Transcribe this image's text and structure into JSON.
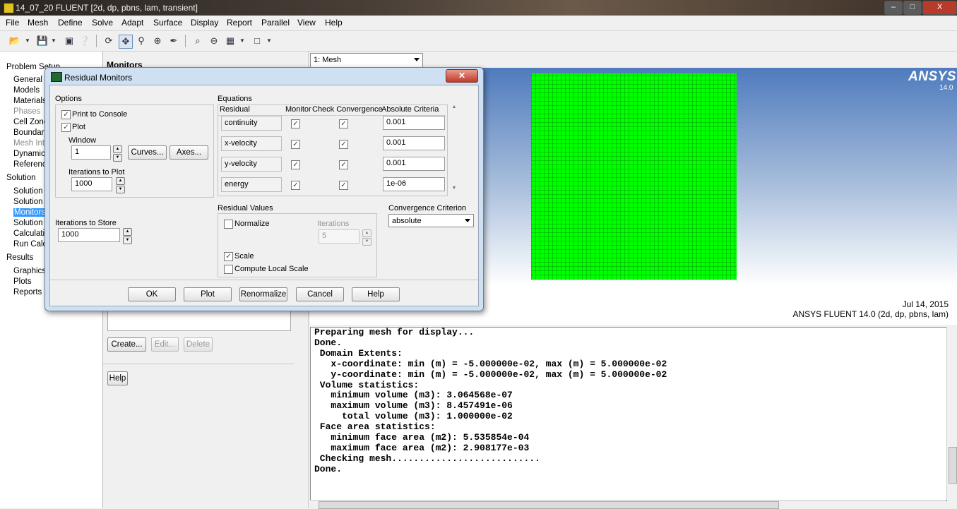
{
  "window": {
    "title": "14_07_20 FLUENT  [2d, dp, pbns, lam, transient]",
    "min": "–",
    "max": "□",
    "close": "X"
  },
  "menu": [
    "File",
    "Mesh",
    "Define",
    "Solve",
    "Adapt",
    "Surface",
    "Display",
    "Report",
    "Parallel",
    "View",
    "Help"
  ],
  "tree": {
    "problem_setup": "Problem Setup",
    "setup_items": [
      "General",
      "Models",
      "Materials",
      "Phases",
      "Cell Zones",
      "Boundary",
      "Mesh Inte",
      "Dynamic",
      "Referenc"
    ],
    "solution": "Solution",
    "solution_items": [
      "Solution M",
      "Solution C",
      "Monitors",
      "Solution I",
      "Calculatio",
      "Run Calcu"
    ],
    "results": "Results",
    "results_items": [
      "Graphics",
      "Plots",
      "Reports"
    ]
  },
  "task": {
    "title": "Monitors",
    "create": "Create...",
    "edit": "Edit...",
    "delete": "Delete",
    "help": "Help"
  },
  "graphics": {
    "view_select": "1: Mesh",
    "logo": "ANSYS",
    "logo_version": "14.0",
    "date": "Jul 14, 2015",
    "product": "ANSYS FLUENT 14.0 (2d, dp, pbns, lam)"
  },
  "console": [
    "Preparing mesh for display...",
    "Done.",
    "",
    " Domain Extents:",
    "   x-coordinate: min (m) = -5.000000e-02, max (m) = 5.000000e-02",
    "   y-coordinate: min (m) = -5.000000e-02, max (m) = 5.000000e-02",
    " Volume statistics:",
    "   minimum volume (m3): 3.064568e-07",
    "   maximum volume (m3): 8.457491e-06",
    "     total volume (m3): 1.000000e-02",
    " Face area statistics:",
    "   minimum face area (m2): 5.535854e-04",
    "   maximum face area (m2): 2.908177e-03",
    " Checking mesh...........................",
    "Done."
  ],
  "dialog": {
    "title": "Residual Monitors",
    "close": "✕",
    "options": {
      "label": "Options",
      "print_to_console": "Print to Console",
      "plot": "Plot",
      "window_label": "Window",
      "window_value": "1",
      "curves": "Curves...",
      "axes": "Axes...",
      "iter_plot_label": "Iterations to Plot",
      "iter_plot_value": "1000",
      "iter_store_label": "Iterations to Store",
      "iter_store_value": "1000"
    },
    "equations": {
      "label": "Equations",
      "col_residual": "Residual",
      "col_monitor": "Monitor",
      "col_check": "Check Convergence",
      "col_abs": "Absolute Criteria",
      "rows": [
        {
          "name": "continuity",
          "criteria": "0.001"
        },
        {
          "name": "x-velocity",
          "criteria": "0.001"
        },
        {
          "name": "y-velocity",
          "criteria": "0.001"
        },
        {
          "name": "energy",
          "criteria": "1e-06"
        }
      ]
    },
    "residual_values": {
      "label": "Residual Values",
      "normalize": "Normalize",
      "iterations_label": "Iterations",
      "iterations_value": "5",
      "scale": "Scale",
      "compute_local": "Compute Local Scale"
    },
    "convergence": {
      "label": "Convergence Criterion",
      "value": "absolute"
    },
    "buttons": {
      "ok": "OK",
      "plot": "Plot",
      "renormalize": "Renormalize",
      "cancel": "Cancel",
      "help": "Help"
    },
    "check_glyph": "✓"
  }
}
